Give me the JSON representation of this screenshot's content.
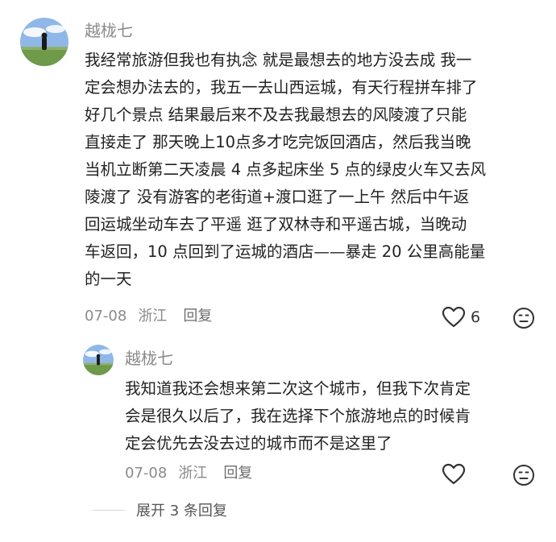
{
  "comment": {
    "username": "越栊七",
    "lines": [
      "我经常旅游但我也有执念 就是最想去的地方没去成 我一",
      "定会想办法去的，我五一去山西运城，有天行程拼车排了",
      "好几个景点 结果最后来不及去我最想去的风陵渡了只能",
      "直接走了 那天晚上10点多才吃完饭回酒店，然后我当晚",
      "当机立断第二天凌晨 4 点多起床坐 5 点的绿皮火车又去风",
      "陵渡了 没有游客的老街道+渡口逛了一上午 然后中午返",
      "回运城坐动车去了平遥 逛了双林寺和平遥古城，当晚动",
      "车返回，10 点回到了运城的酒店——暴走 20 公里高能量",
      "的一天"
    ],
    "date": "07-08",
    "location": "浙江",
    "reply_label": "回复",
    "like_count": "6"
  },
  "reply": {
    "username": "越栊七",
    "lines": [
      "我知道我还会想来第二次这个城市，但我下次肯定",
      "会是很久以后了，我在选择下个旅游地点的时候肯",
      "定会优先去没去过的城市而不是这里了"
    ],
    "date": "07-08",
    "location": "浙江",
    "reply_label": "回复"
  },
  "expand": {
    "label": "展开 3 条回复"
  },
  "icons": {
    "like": "heart-outline-icon",
    "dislike": "neutral-face-icon"
  },
  "colors": {
    "meta_gray": "#8a8a8a",
    "text": "#222222"
  }
}
